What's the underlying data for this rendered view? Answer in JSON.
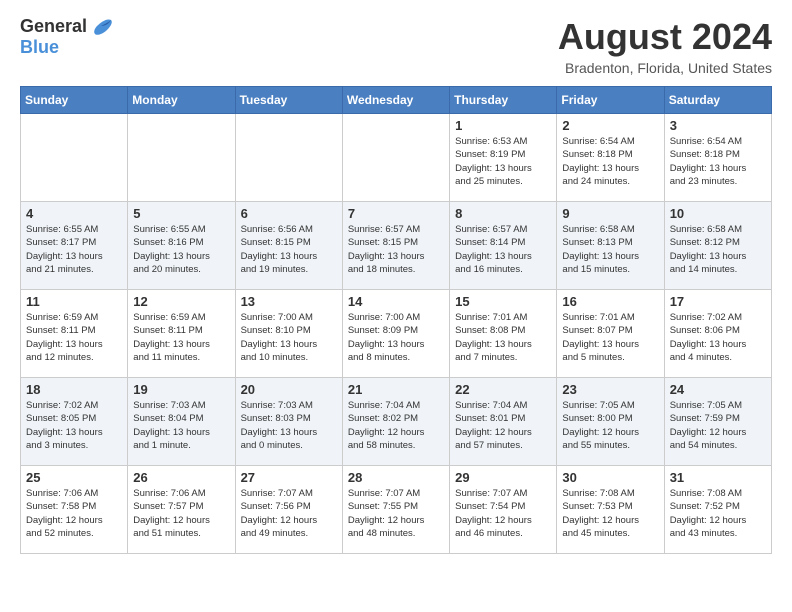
{
  "header": {
    "logo_general": "General",
    "logo_blue": "Blue",
    "title": "August 2024",
    "location": "Bradenton, Florida, United States"
  },
  "calendar": {
    "columns": [
      "Sunday",
      "Monday",
      "Tuesday",
      "Wednesday",
      "Thursday",
      "Friday",
      "Saturday"
    ],
    "rows": [
      [
        {
          "day": "",
          "info": ""
        },
        {
          "day": "",
          "info": ""
        },
        {
          "day": "",
          "info": ""
        },
        {
          "day": "",
          "info": ""
        },
        {
          "day": "1",
          "info": "Sunrise: 6:53 AM\nSunset: 8:19 PM\nDaylight: 13 hours\nand 25 minutes."
        },
        {
          "day": "2",
          "info": "Sunrise: 6:54 AM\nSunset: 8:18 PM\nDaylight: 13 hours\nand 24 minutes."
        },
        {
          "day": "3",
          "info": "Sunrise: 6:54 AM\nSunset: 8:18 PM\nDaylight: 13 hours\nand 23 minutes."
        }
      ],
      [
        {
          "day": "4",
          "info": "Sunrise: 6:55 AM\nSunset: 8:17 PM\nDaylight: 13 hours\nand 21 minutes."
        },
        {
          "day": "5",
          "info": "Sunrise: 6:55 AM\nSunset: 8:16 PM\nDaylight: 13 hours\nand 20 minutes."
        },
        {
          "day": "6",
          "info": "Sunrise: 6:56 AM\nSunset: 8:15 PM\nDaylight: 13 hours\nand 19 minutes."
        },
        {
          "day": "7",
          "info": "Sunrise: 6:57 AM\nSunset: 8:15 PM\nDaylight: 13 hours\nand 18 minutes."
        },
        {
          "day": "8",
          "info": "Sunrise: 6:57 AM\nSunset: 8:14 PM\nDaylight: 13 hours\nand 16 minutes."
        },
        {
          "day": "9",
          "info": "Sunrise: 6:58 AM\nSunset: 8:13 PM\nDaylight: 13 hours\nand 15 minutes."
        },
        {
          "day": "10",
          "info": "Sunrise: 6:58 AM\nSunset: 8:12 PM\nDaylight: 13 hours\nand 14 minutes."
        }
      ],
      [
        {
          "day": "11",
          "info": "Sunrise: 6:59 AM\nSunset: 8:11 PM\nDaylight: 13 hours\nand 12 minutes."
        },
        {
          "day": "12",
          "info": "Sunrise: 6:59 AM\nSunset: 8:11 PM\nDaylight: 13 hours\nand 11 minutes."
        },
        {
          "day": "13",
          "info": "Sunrise: 7:00 AM\nSunset: 8:10 PM\nDaylight: 13 hours\nand 10 minutes."
        },
        {
          "day": "14",
          "info": "Sunrise: 7:00 AM\nSunset: 8:09 PM\nDaylight: 13 hours\nand 8 minutes."
        },
        {
          "day": "15",
          "info": "Sunrise: 7:01 AM\nSunset: 8:08 PM\nDaylight: 13 hours\nand 7 minutes."
        },
        {
          "day": "16",
          "info": "Sunrise: 7:01 AM\nSunset: 8:07 PM\nDaylight: 13 hours\nand 5 minutes."
        },
        {
          "day": "17",
          "info": "Sunrise: 7:02 AM\nSunset: 8:06 PM\nDaylight: 13 hours\nand 4 minutes."
        }
      ],
      [
        {
          "day": "18",
          "info": "Sunrise: 7:02 AM\nSunset: 8:05 PM\nDaylight: 13 hours\nand 3 minutes."
        },
        {
          "day": "19",
          "info": "Sunrise: 7:03 AM\nSunset: 8:04 PM\nDaylight: 13 hours\nand 1 minute."
        },
        {
          "day": "20",
          "info": "Sunrise: 7:03 AM\nSunset: 8:03 PM\nDaylight: 13 hours\nand 0 minutes."
        },
        {
          "day": "21",
          "info": "Sunrise: 7:04 AM\nSunset: 8:02 PM\nDaylight: 12 hours\nand 58 minutes."
        },
        {
          "day": "22",
          "info": "Sunrise: 7:04 AM\nSunset: 8:01 PM\nDaylight: 12 hours\nand 57 minutes."
        },
        {
          "day": "23",
          "info": "Sunrise: 7:05 AM\nSunset: 8:00 PM\nDaylight: 12 hours\nand 55 minutes."
        },
        {
          "day": "24",
          "info": "Sunrise: 7:05 AM\nSunset: 7:59 PM\nDaylight: 12 hours\nand 54 minutes."
        }
      ],
      [
        {
          "day": "25",
          "info": "Sunrise: 7:06 AM\nSunset: 7:58 PM\nDaylight: 12 hours\nand 52 minutes."
        },
        {
          "day": "26",
          "info": "Sunrise: 7:06 AM\nSunset: 7:57 PM\nDaylight: 12 hours\nand 51 minutes."
        },
        {
          "day": "27",
          "info": "Sunrise: 7:07 AM\nSunset: 7:56 PM\nDaylight: 12 hours\nand 49 minutes."
        },
        {
          "day": "28",
          "info": "Sunrise: 7:07 AM\nSunset: 7:55 PM\nDaylight: 12 hours\nand 48 minutes."
        },
        {
          "day": "29",
          "info": "Sunrise: 7:07 AM\nSunset: 7:54 PM\nDaylight: 12 hours\nand 46 minutes."
        },
        {
          "day": "30",
          "info": "Sunrise: 7:08 AM\nSunset: 7:53 PM\nDaylight: 12 hours\nand 45 minutes."
        },
        {
          "day": "31",
          "info": "Sunrise: 7:08 AM\nSunset: 7:52 PM\nDaylight: 12 hours\nand 43 minutes."
        }
      ]
    ]
  }
}
